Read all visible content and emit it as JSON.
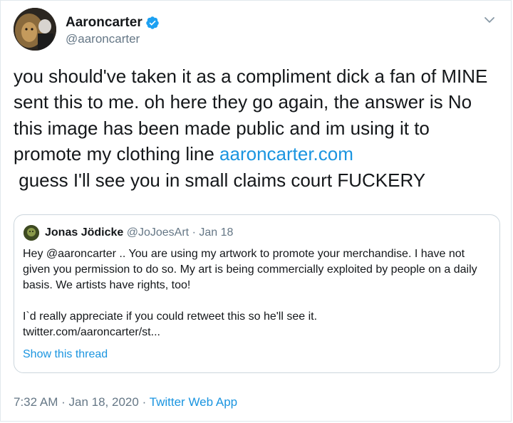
{
  "tweet": {
    "display_name": "Aaroncarter",
    "handle": "@aaroncarter",
    "text_part1": "you should've taken it as a compliment dick a fan of MINE sent this to me. oh here they go again, the answer is No this image has been made public and im using it to promote my clothing line ",
    "link_text": "aaroncarter.com",
    "text_part2": "\n guess I'll see you in small claims court FUCKERY",
    "time": "7:32 AM",
    "date": "Jan 18, 2020",
    "separator": "·",
    "source": "Twitter Web App"
  },
  "quote": {
    "display_name": "Jonas Jödicke",
    "handle": "@JoJoesArt",
    "separator": "·",
    "date": "Jan 18",
    "paragraph1": "Hey @aaroncarter .. You are using my artwork to promote your merchandise. I have not given you permission to do so. My art is being commercially exploited by people on a daily basis. We artists have rights, too!",
    "paragraph2": "I`d really appreciate if you could retweet this so he'll see it.",
    "paragraph3": "twitter.com/aaroncarter/st...",
    "show_thread": "Show this thread"
  },
  "icons": {
    "verified": "verified-badge-icon",
    "caret": "chevron-down-icon"
  },
  "colors": {
    "link": "#1b95e0",
    "secondary_text": "#657786",
    "border": "#ccd6dd"
  }
}
